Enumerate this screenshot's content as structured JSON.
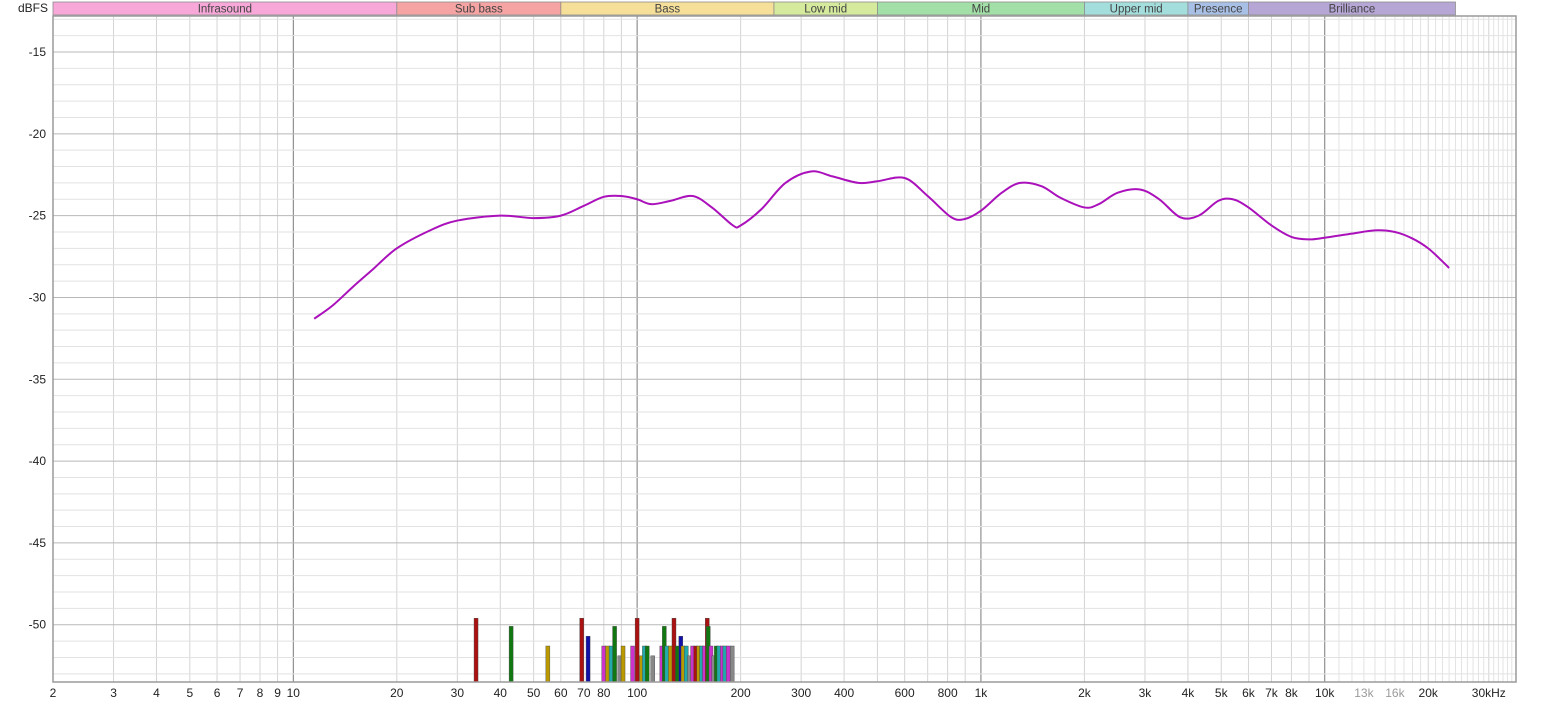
{
  "chart_data": {
    "type": "line",
    "title": "",
    "ylabel": "dBFS",
    "xlabel": "",
    "x_scale": "log",
    "xlim": [
      2,
      36000
    ],
    "ylim": [
      -53.5,
      -12.8
    ],
    "grid": true,
    "y_ticks": [
      -15,
      -20,
      -25,
      -30,
      -35,
      -40,
      -45,
      -50
    ],
    "y_tick_labels": [
      "-15",
      "-20",
      "-25",
      "-30",
      "-35",
      "-40",
      "-45",
      "-50"
    ],
    "x_ticks": [
      {
        "value": 2,
        "label": "2",
        "muted": false
      },
      {
        "value": 3,
        "label": "3",
        "muted": false
      },
      {
        "value": 4,
        "label": "4",
        "muted": false
      },
      {
        "value": 5,
        "label": "5",
        "muted": false
      },
      {
        "value": 6,
        "label": "6",
        "muted": false
      },
      {
        "value": 7,
        "label": "7",
        "muted": false
      },
      {
        "value": 8,
        "label": "8",
        "muted": false
      },
      {
        "value": 9,
        "label": "9",
        "muted": false
      },
      {
        "value": 10,
        "label": "10",
        "muted": false
      },
      {
        "value": 20,
        "label": "20",
        "muted": false
      },
      {
        "value": 30,
        "label": "30",
        "muted": false
      },
      {
        "value": 40,
        "label": "40",
        "muted": false
      },
      {
        "value": 50,
        "label": "50",
        "muted": false
      },
      {
        "value": 60,
        "label": "60",
        "muted": false
      },
      {
        "value": 70,
        "label": "70",
        "muted": false
      },
      {
        "value": 80,
        "label": "80",
        "muted": false
      },
      {
        "value": 100,
        "label": "100",
        "muted": false
      },
      {
        "value": 200,
        "label": "200",
        "muted": false
      },
      {
        "value": 300,
        "label": "300",
        "muted": false
      },
      {
        "value": 400,
        "label": "400",
        "muted": false
      },
      {
        "value": 600,
        "label": "600",
        "muted": false
      },
      {
        "value": 800,
        "label": "800",
        "muted": false
      },
      {
        "value": 1000,
        "label": "1k",
        "muted": false
      },
      {
        "value": 2000,
        "label": "2k",
        "muted": false
      },
      {
        "value": 3000,
        "label": "3k",
        "muted": false
      },
      {
        "value": 4000,
        "label": "4k",
        "muted": false
      },
      {
        "value": 5000,
        "label": "5k",
        "muted": false
      },
      {
        "value": 6000,
        "label": "6k",
        "muted": false
      },
      {
        "value": 7000,
        "label": "7k",
        "muted": false
      },
      {
        "value": 8000,
        "label": "8k",
        "muted": false
      },
      {
        "value": 10000,
        "label": "10k",
        "muted": false
      },
      {
        "value": 13000,
        "label": "13k",
        "muted": true
      },
      {
        "value": 16000,
        "label": "16k",
        "muted": true
      },
      {
        "value": 20000,
        "label": "20k",
        "muted": false
      },
      {
        "value": 30000,
        "label": "30kHz",
        "muted": false
      }
    ],
    "bands": [
      {
        "label": "Infrasound",
        "from": 2,
        "to": 20,
        "color": "#f7a8d8"
      },
      {
        "label": "Sub bass",
        "from": 20,
        "to": 60,
        "color": "#f5a3a3"
      },
      {
        "label": "Bass",
        "from": 60,
        "to": 250,
        "color": "#f6df98"
      },
      {
        "label": "Low mid",
        "from": 250,
        "to": 500,
        "color": "#d5ea9c"
      },
      {
        "label": "Mid",
        "from": 500,
        "to": 2000,
        "color": "#a3e0a8"
      },
      {
        "label": "Upper mid",
        "from": 2000,
        "to": 4000,
        "color": "#a3dedc"
      },
      {
        "label": "Presence",
        "from": 4000,
        "to": 6000,
        "color": "#a9c0e6"
      },
      {
        "label": "Brilliance",
        "from": 6000,
        "to": 24000,
        "color": "#b6a6d6"
      }
    ],
    "series": [
      {
        "color": "#aa11bb",
        "points": [
          [
            11.5,
            -31.3
          ],
          [
            13,
            -30.5
          ],
          [
            15,
            -29.3
          ],
          [
            17,
            -28.3
          ],
          [
            20,
            -27.0
          ],
          [
            25,
            -25.9
          ],
          [
            30,
            -25.3
          ],
          [
            40,
            -25.0
          ],
          [
            50,
            -25.15
          ],
          [
            60,
            -25.0
          ],
          [
            70,
            -24.4
          ],
          [
            80,
            -23.85
          ],
          [
            90,
            -23.8
          ],
          [
            100,
            -24.0
          ],
          [
            110,
            -24.3
          ],
          [
            125,
            -24.1
          ],
          [
            145,
            -23.8
          ],
          [
            165,
            -24.5
          ],
          [
            190,
            -25.6
          ],
          [
            200,
            -25.6
          ],
          [
            230,
            -24.6
          ],
          [
            270,
            -23.0
          ],
          [
            320,
            -22.3
          ],
          [
            370,
            -22.6
          ],
          [
            440,
            -23.0
          ],
          [
            500,
            -22.9
          ],
          [
            600,
            -22.7
          ],
          [
            700,
            -23.8
          ],
          [
            820,
            -25.1
          ],
          [
            900,
            -25.2
          ],
          [
            1000,
            -24.7
          ],
          [
            1150,
            -23.6
          ],
          [
            1300,
            -23.0
          ],
          [
            1500,
            -23.2
          ],
          [
            1700,
            -23.9
          ],
          [
            2000,
            -24.5
          ],
          [
            2200,
            -24.3
          ],
          [
            2500,
            -23.6
          ],
          [
            2900,
            -23.4
          ],
          [
            3300,
            -24.0
          ],
          [
            3800,
            -25.1
          ],
          [
            4300,
            -25.0
          ],
          [
            4900,
            -24.1
          ],
          [
            5400,
            -24.0
          ],
          [
            6000,
            -24.5
          ],
          [
            7000,
            -25.6
          ],
          [
            8000,
            -26.3
          ],
          [
            9000,
            -26.45
          ],
          [
            10000,
            -26.35
          ],
          [
            12000,
            -26.1
          ],
          [
            14000,
            -25.9
          ],
          [
            16000,
            -26.0
          ],
          [
            18000,
            -26.4
          ],
          [
            20000,
            -27.0
          ],
          [
            22000,
            -27.8
          ],
          [
            23000,
            -28.2
          ]
        ]
      }
    ],
    "bar_floor": -53.5,
    "bars": [
      {
        "x": 34,
        "y": -49.6,
        "color": "#aa1111"
      },
      {
        "x": 43,
        "y": -50.1,
        "color": "#117711"
      },
      {
        "x": 55,
        "y": -51.3,
        "color": "#bb9900"
      },
      {
        "x": 69,
        "y": -49.6,
        "color": "#aa1111"
      },
      {
        "x": 72,
        "y": -50.7,
        "color": "#1111aa"
      },
      {
        "x": 80,
        "y": -51.3,
        "color": "#cc33cc"
      },
      {
        "x": 82,
        "y": -51.3,
        "color": "#bb9900"
      },
      {
        "x": 84,
        "y": -51.3,
        "color": "#22aaaa"
      },
      {
        "x": 86,
        "y": -50.1,
        "color": "#117711"
      },
      {
        "x": 89,
        "y": -51.9,
        "color": "#888888"
      },
      {
        "x": 91,
        "y": -51.3,
        "color": "#bb9900"
      },
      {
        "x": 97,
        "y": -51.3,
        "color": "#cc33cc"
      },
      {
        "x": 100,
        "y": -49.6,
        "color": "#aa1111"
      },
      {
        "x": 103,
        "y": -51.9,
        "color": "#bb9900"
      },
      {
        "x": 105,
        "y": -51.3,
        "color": "#22aaaa"
      },
      {
        "x": 107,
        "y": -51.3,
        "color": "#117711"
      },
      {
        "x": 111,
        "y": -51.9,
        "color": "#888888"
      },
      {
        "x": 118,
        "y": -51.3,
        "color": "#cc33cc"
      },
      {
        "x": 120,
        "y": -50.1,
        "color": "#117711"
      },
      {
        "x": 122,
        "y": -51.3,
        "color": "#22aaaa"
      },
      {
        "x": 125,
        "y": -51.3,
        "color": "#bb9900"
      },
      {
        "x": 128,
        "y": -49.6,
        "color": "#aa1111"
      },
      {
        "x": 131,
        "y": -51.3,
        "color": "#117711"
      },
      {
        "x": 134,
        "y": -50.7,
        "color": "#1111aa"
      },
      {
        "x": 136,
        "y": -51.3,
        "color": "#bb9900"
      },
      {
        "x": 139,
        "y": -51.3,
        "color": "#22aaaa"
      },
      {
        "x": 142,
        "y": -51.9,
        "color": "#888888"
      },
      {
        "x": 145,
        "y": -51.3,
        "color": "#cc33cc"
      },
      {
        "x": 148,
        "y": -51.3,
        "color": "#aa1111"
      },
      {
        "x": 151,
        "y": -51.3,
        "color": "#bb9900"
      },
      {
        "x": 154,
        "y": -51.3,
        "color": "#22aaaa"
      },
      {
        "x": 157,
        "y": -51.3,
        "color": "#cc33cc"
      },
      {
        "x": 160,
        "y": -49.6,
        "color": "#aa1111"
      },
      {
        "x": 161,
        "y": -50.1,
        "color": "#117711"
      },
      {
        "x": 164,
        "y": -51.3,
        "color": "#cc33cc"
      },
      {
        "x": 167,
        "y": -51.9,
        "color": "#888888"
      },
      {
        "x": 170,
        "y": -51.3,
        "color": "#117711"
      },
      {
        "x": 173,
        "y": -51.3,
        "color": "#22aaaa"
      },
      {
        "x": 177,
        "y": -51.3,
        "color": "#cc33cc"
      },
      {
        "x": 180,
        "y": -51.3,
        "color": "#22aaaa"
      },
      {
        "x": 184,
        "y": -51.3,
        "color": "#cc33cc"
      },
      {
        "x": 189,
        "y": -51.3,
        "color": "#888888"
      }
    ]
  }
}
